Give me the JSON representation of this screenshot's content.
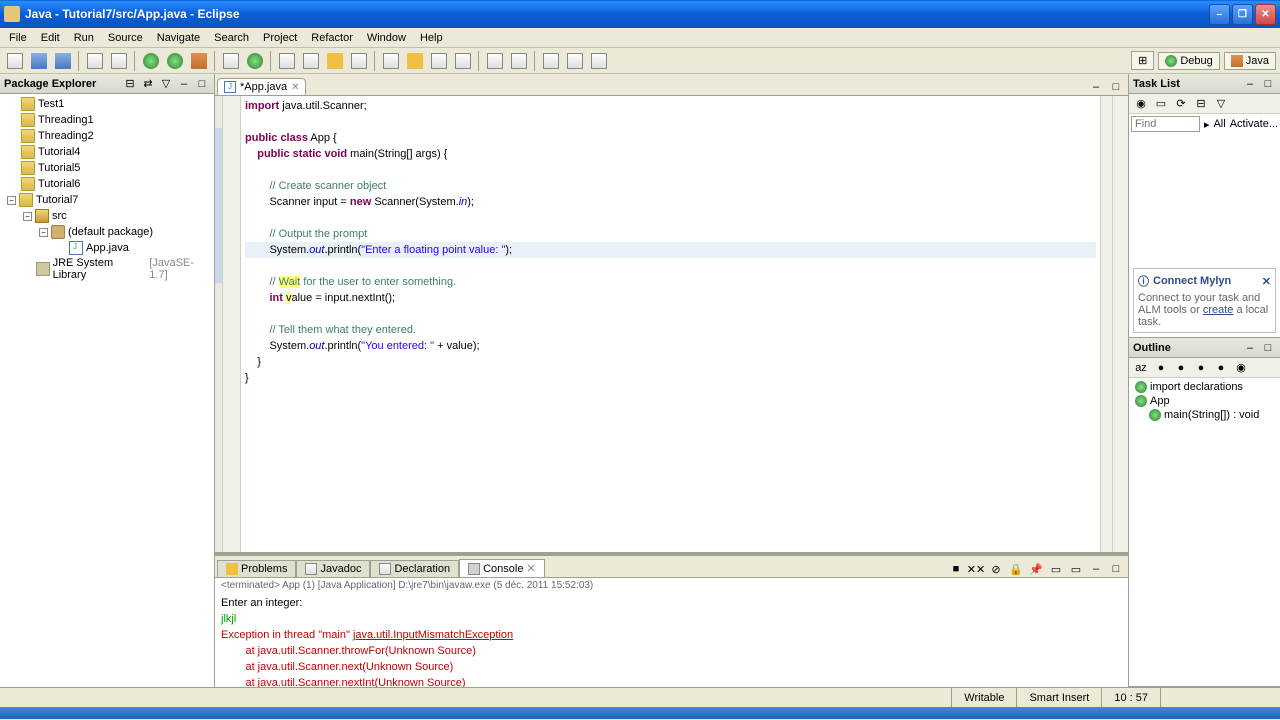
{
  "titlebar": {
    "text": "Java - Tutorial7/src/App.java - Eclipse"
  },
  "menubar": [
    "File",
    "Edit",
    "Run",
    "Source",
    "Navigate",
    "Search",
    "Project",
    "Refactor",
    "Window",
    "Help"
  ],
  "perspectives": {
    "debug": "Debug",
    "java": "Java"
  },
  "package_explorer": {
    "title": "Package Explorer",
    "items": [
      {
        "label": "Test1",
        "indent": 0,
        "icon": "folder"
      },
      {
        "label": "Threading1",
        "indent": 0,
        "icon": "folder"
      },
      {
        "label": "Threading2",
        "indent": 0,
        "icon": "folder"
      },
      {
        "label": "Tutorial4",
        "indent": 0,
        "icon": "folder"
      },
      {
        "label": "Tutorial5",
        "indent": 0,
        "icon": "folder"
      },
      {
        "label": "Tutorial6",
        "indent": 0,
        "icon": "folder"
      },
      {
        "label": "Tutorial7",
        "indent": 0,
        "icon": "folder",
        "expanded": true
      },
      {
        "label": "src",
        "indent": 1,
        "icon": "src",
        "expanded": true
      },
      {
        "label": "(default package)",
        "indent": 2,
        "icon": "pkg",
        "expanded": true
      },
      {
        "label": "App.java",
        "indent": 3,
        "icon": "java"
      },
      {
        "label": "JRE System Library",
        "suffix": "[JavaSE-1.7]",
        "indent": 1,
        "icon": "lib"
      }
    ]
  },
  "editor": {
    "tab_label": "*App.java",
    "code_lines": [
      {
        "parts": [
          {
            "t": "import",
            "c": "kw"
          },
          {
            "t": " java.util.Scanner;"
          }
        ]
      },
      {
        "parts": []
      },
      {
        "parts": [
          {
            "t": "public class",
            "c": "kw"
          },
          {
            "t": " App {"
          }
        ]
      },
      {
        "parts": [
          {
            "t": "    "
          },
          {
            "t": "public static void",
            "c": "kw"
          },
          {
            "t": " main(String[] args) {"
          }
        ]
      },
      {
        "parts": []
      },
      {
        "parts": [
          {
            "t": "        "
          },
          {
            "t": "// Create scanner object",
            "c": "com"
          }
        ]
      },
      {
        "parts": [
          {
            "t": "        Scanner input = "
          },
          {
            "t": "new",
            "c": "kw"
          },
          {
            "t": " Scanner(System."
          },
          {
            "t": "in",
            "c": "fld"
          },
          {
            "t": ");"
          }
        ]
      },
      {
        "parts": []
      },
      {
        "parts": [
          {
            "t": "        "
          },
          {
            "t": "// Output the prompt",
            "c": "com"
          }
        ]
      },
      {
        "parts": [
          {
            "t": "        System."
          },
          {
            "t": "out",
            "c": "fld"
          },
          {
            "t": ".println("
          },
          {
            "t": "\"Enter a floating point value: \"",
            "c": "str"
          },
          {
            "t": ");"
          }
        ],
        "current": true
      },
      {
        "parts": []
      },
      {
        "parts": [
          {
            "t": "        "
          },
          {
            "t": "// ",
            "c": "com"
          },
          {
            "t": "Wait",
            "c": "com hl"
          },
          {
            "t": " for the user to enter something.",
            "c": "com"
          }
        ]
      },
      {
        "parts": [
          {
            "t": "        "
          },
          {
            "t": "int",
            "c": "kw"
          },
          {
            "t": " "
          },
          {
            "t": "v",
            "c": "hl"
          },
          {
            "t": "alue = input.nextInt();"
          }
        ]
      },
      {
        "parts": []
      },
      {
        "parts": [
          {
            "t": "        "
          },
          {
            "t": "// Tell them what they entered.",
            "c": "com"
          }
        ]
      },
      {
        "parts": [
          {
            "t": "        System."
          },
          {
            "t": "out",
            "c": "fld"
          },
          {
            "t": ".println("
          },
          {
            "t": "\"You entered: \"",
            "c": "str"
          },
          {
            "t": " + value);"
          }
        ]
      },
      {
        "parts": [
          {
            "t": "    }"
          }
        ]
      },
      {
        "parts": [
          {
            "t": "}"
          }
        ]
      }
    ]
  },
  "bottom": {
    "tabs": [
      "Problems",
      "Javadoc",
      "Declaration",
      "Console"
    ],
    "active_tab": 3,
    "console_info": "<terminated> App (1) [Java Application] D:\\jre7\\bin\\javaw.exe (5 déc. 2011 15:52:03)",
    "console_lines": [
      {
        "t": "Enter an integer: ",
        "c": "con-out"
      },
      {
        "t": "jlkjl",
        "c": "con-in"
      },
      {
        "t": "Exception in thread \"main\" ",
        "c": "con-err",
        "link": "java.util.InputMismatchException"
      },
      {
        "t": "        at java.util.Scanner.throwFor(Unknown Source)",
        "c": "con-err"
      },
      {
        "t": "        at java.util.Scanner.next(Unknown Source)",
        "c": "con-err"
      },
      {
        "t": "        at java.util.Scanner.nextInt(Unknown Source)",
        "c": "con-err"
      }
    ]
  },
  "tasklist": {
    "title": "Task List",
    "find": "Find",
    "all": "All",
    "activate": "Activate..."
  },
  "mylyn": {
    "title": "Connect Mylyn",
    "text_prefix": "Connect to your task and ALM tools or ",
    "link": "create",
    "text_suffix": " a local task."
  },
  "outline": {
    "title": "Outline",
    "items": [
      {
        "label": "import declarations",
        "indent": 0
      },
      {
        "label": "App",
        "indent": 0
      },
      {
        "label": "main(String[]) : void",
        "indent": 1
      }
    ]
  },
  "statusbar": {
    "writable": "Writable",
    "insert": "Smart Insert",
    "pos": "10 : 57"
  }
}
